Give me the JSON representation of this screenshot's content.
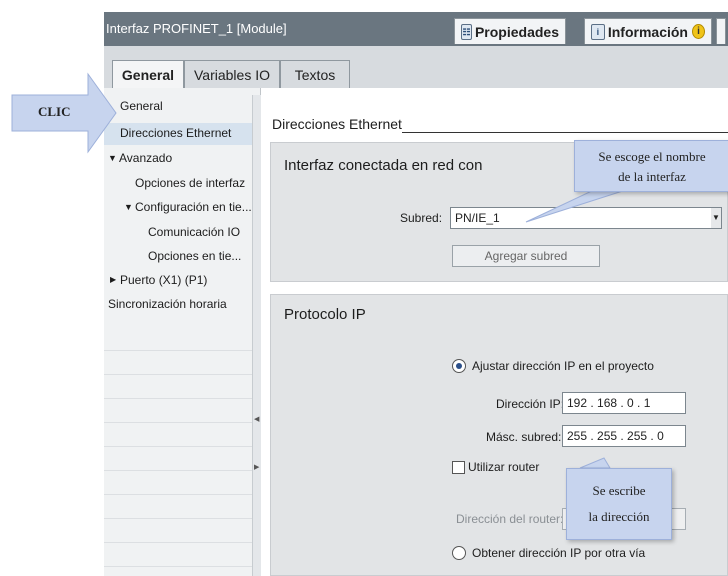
{
  "window": {
    "title": "Interfaz PROFINET_1 [Module]",
    "properties_tab": "Propiedades",
    "info_tab": "Información",
    "diagnostics_icon": "info-icon"
  },
  "tabs": [
    "General",
    "Variables IO",
    "Textos"
  ],
  "nav": {
    "items": [
      {
        "label": "General"
      },
      {
        "label": "Direcciones Ethernet",
        "selected": true
      },
      {
        "label": "Avanzado",
        "expander": "▼"
      },
      {
        "label": "Opciones de interfaz"
      },
      {
        "label": "Configuración en tie...",
        "expander": "▼"
      },
      {
        "label": "Comunicación IO"
      },
      {
        "label": "Opciones en tie..."
      },
      {
        "label": "Puerto (X1) (P1)",
        "expander": "▶"
      },
      {
        "label": "Sincronización horaria"
      }
    ]
  },
  "main": {
    "section_title": "Direcciones Ethernet",
    "network": {
      "title": "Interfaz conectada en red con",
      "subnet_label": "Subred:",
      "subnet_value": "PN/IE_1",
      "add_subnet": "Agregar subred"
    },
    "ip": {
      "title": "Protocolo IP",
      "set_in_project": "Ajustar dirección IP en el proyecto",
      "ip_label": "Dirección IP:",
      "ip_value": "192 . 168 . 0 . 1",
      "mask_label": "Másc. subred:",
      "mask_value": "255 . 255 . 255 . 0",
      "use_router": "Utilizar router",
      "router_label": "Dirección del router:",
      "other_way": "Obtener dirección IP por otra vía"
    }
  },
  "annotations": {
    "clic": "CLIC",
    "interface_line1": "Se escoge el nombre",
    "interface_line2": "de la interfaz",
    "address_line1": "Se escribe",
    "address_line2": "la dirección"
  },
  "colors": {
    "titlebar": "#6a7680",
    "selection": "#d6e2ee",
    "callout": "#c7d4ee"
  }
}
